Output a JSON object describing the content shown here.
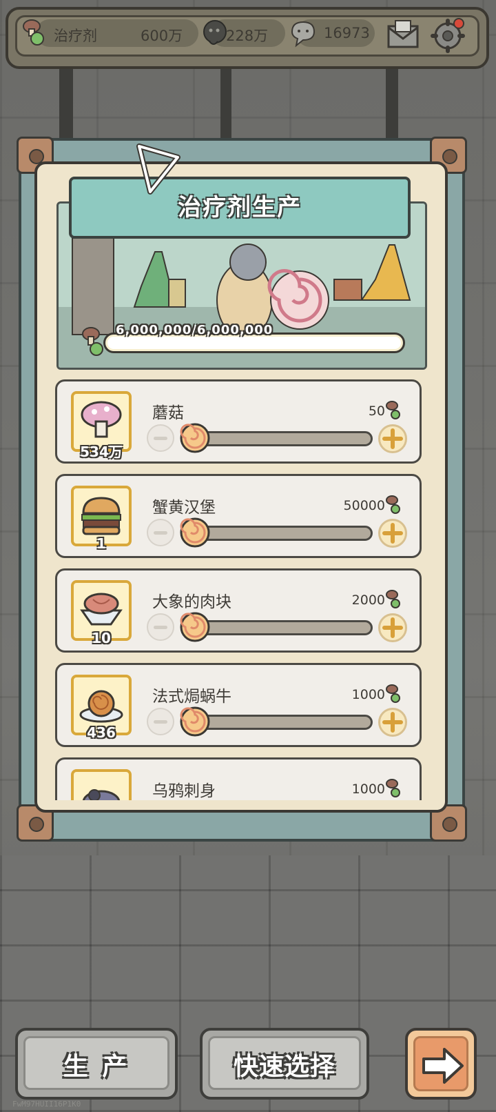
{
  "topbar": {
    "resource_label": "治疗剂",
    "resource_value": "600万",
    "currency1_value": "228万",
    "currency2_value": "16973"
  },
  "panel": {
    "title": "治疗剂生产",
    "progress_text": "6,000,000/6,000,000",
    "progress_fraction": 1.0
  },
  "items": [
    {
      "name": "蘑菇",
      "count": "534万",
      "cost": "50"
    },
    {
      "name": "蟹黄汉堡",
      "count": "1",
      "cost": "50000"
    },
    {
      "name": "大象的肉块",
      "count": "10",
      "cost": "2000"
    },
    {
      "name": "法式焗蜗牛",
      "count": "436",
      "cost": "1000"
    },
    {
      "name": "乌鸦刺身",
      "count": "",
      "cost": "1000"
    }
  ],
  "buttons": {
    "produce": "生 产",
    "quick_select": "快速选择"
  },
  "watermark": "FwM97HUII16P1K0",
  "colors": {
    "panel_bg": "#efe5cc",
    "banner": "#8ec9c0",
    "thumb_border": "#d9a83a",
    "next_button": "#e89a6a"
  }
}
